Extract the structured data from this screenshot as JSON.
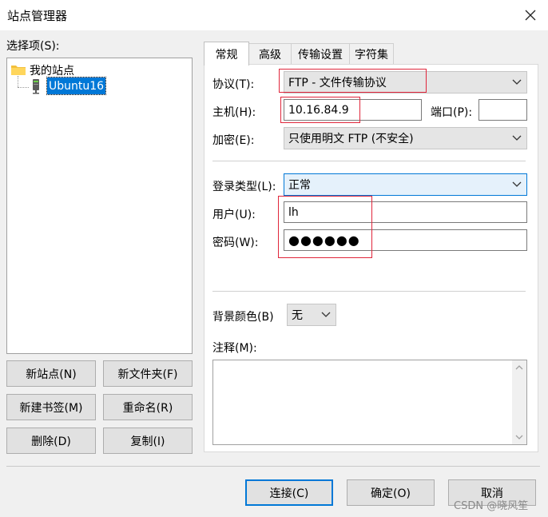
{
  "window": {
    "title": "站点管理器"
  },
  "left": {
    "select_label": "选择项(S):",
    "tree": {
      "root": "我的站点",
      "child": "Ubuntu16"
    },
    "buttons": {
      "new_site": "新站点(N)",
      "new_folder": "新文件夹(F)",
      "new_bookmark": "新建书签(M)",
      "rename": "重命名(R)",
      "delete": "删除(D)",
      "copy": "复制(I)"
    }
  },
  "tabs": [
    "常规",
    "高级",
    "传输设置",
    "字符集"
  ],
  "general": {
    "protocol_label": "协议(T):",
    "protocol_value": "FTP - 文件传输协议",
    "host_label": "主机(H):",
    "host_value": "10.16.84.9",
    "port_label": "端口(P):",
    "port_value": "",
    "encryption_label": "加密(E):",
    "encryption_value": "只使用明文 FTP (不安全)",
    "logon_type_label": "登录类型(L):",
    "logon_type_value": "正常",
    "user_label": "用户(U):",
    "user_value": "lh",
    "password_label": "密码(W):",
    "password_value": "●●●●●●",
    "bg_color_label": "背景颜色(B)",
    "bg_color_value": "无",
    "comments_label": "注释(M):",
    "comments_value": ""
  },
  "footer": {
    "connect": "连接(C)",
    "ok": "确定(O)",
    "cancel": "取消"
  },
  "watermark": "CSDN @晓风笙",
  "colors": {
    "highlight": "#e0263b",
    "selection": "#0078d7",
    "focus_combo_bg": "#e5f1fb"
  }
}
